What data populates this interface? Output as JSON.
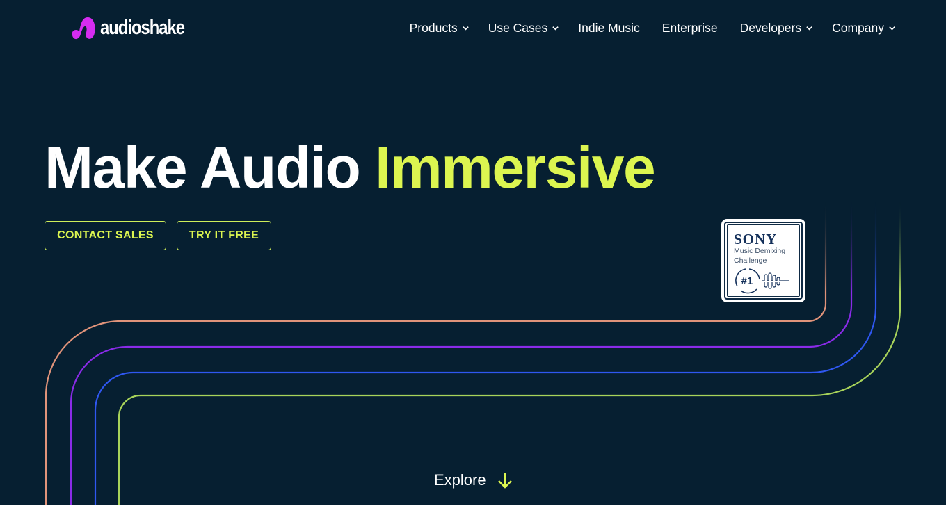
{
  "brand": {
    "name": "audioshake",
    "logo_icon": "audioshake-logo-icon",
    "logo_color": "#d52cf0"
  },
  "nav": {
    "items": [
      {
        "label": "Products",
        "has_dropdown": true
      },
      {
        "label": "Use Cases",
        "has_dropdown": true
      },
      {
        "label": "Indie Music",
        "has_dropdown": false
      },
      {
        "label": "Enterprise",
        "has_dropdown": false
      },
      {
        "label": "Developers",
        "has_dropdown": true
      },
      {
        "label": "Company",
        "has_dropdown": true
      }
    ]
  },
  "hero": {
    "title_main": "Make Audio ",
    "title_accent": "Immersive",
    "accent_color": "#dcf550",
    "background_color": "#061f31",
    "buttons": {
      "contact_sales": "CONTACT SALES",
      "try_free": "TRY IT FREE"
    },
    "badge": {
      "brand": "SONY",
      "line1": "Music Demixing",
      "line2": "Challenge",
      "rank": "#1"
    },
    "explore": {
      "label": "Explore",
      "icon": "arrow-down-icon"
    },
    "line_colors": [
      "#e0937a",
      "#8a2be8",
      "#2f57f0",
      "#a8d35a"
    ]
  }
}
